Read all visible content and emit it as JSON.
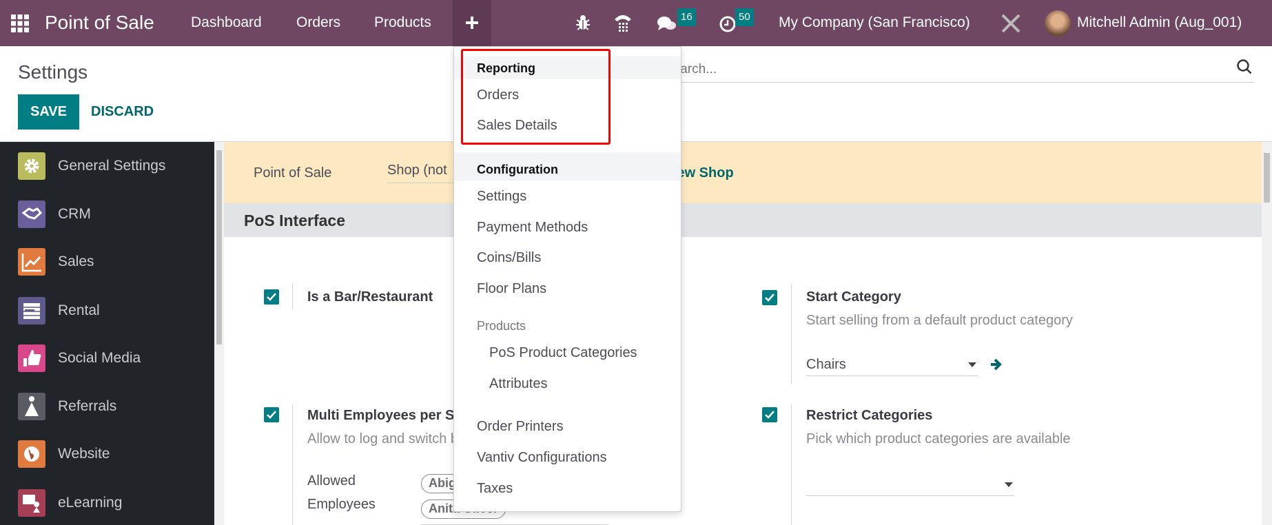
{
  "navbar": {
    "app_title": "Point of Sale",
    "menu": [
      "Dashboard",
      "Orders",
      "Products"
    ],
    "new_icon": "plus-icon",
    "messages_count": "16",
    "activities_count": "50",
    "company": "My Company (San Francisco)",
    "user": "Mitchell Admin (Aug_001)",
    "color": "#704762"
  },
  "control_panel": {
    "title": "Settings",
    "save_label": "SAVE",
    "discard_label": "DISCARD",
    "search_placeholder": "Search..."
  },
  "sidebar": {
    "items": [
      {
        "label": "General Settings",
        "color": "#b9bb5c"
      },
      {
        "label": "CRM",
        "color": "#6b5e9c"
      },
      {
        "label": "Sales",
        "color": "#e07a3f"
      },
      {
        "label": "Rental",
        "color": "#5e5a8e"
      },
      {
        "label": "Social Media",
        "color": "#d8488a"
      },
      {
        "label": "Referrals",
        "color": "#5b5b63"
      },
      {
        "label": "Website",
        "color": "#e07a3f"
      },
      {
        "label": "eLearning",
        "color": "#a63f55"
      }
    ]
  },
  "content": {
    "shop_bar": {
      "label": "Point of Sale",
      "shop_value": "Shop (not",
      "new_shop": "New Shop"
    },
    "section": "PoS Interface",
    "settings": [
      {
        "title": "Is a Bar/Restaurant",
        "checked": true
      },
      {
        "title": "Multi Employees per Session",
        "desc": "Allow to log and switch between selected Employees",
        "checked": true,
        "field_label_1": "Allowed",
        "field_label_2": "Employees",
        "tags": [
          "Abigail Peterson",
          "Anita Oliver"
        ]
      },
      {
        "title": "Start Category",
        "desc": "Start selling from a default product category",
        "value": "Chairs",
        "checked": true
      },
      {
        "title": "Restrict Categories",
        "desc": "Pick which product categories are available",
        "value": "",
        "checked": true
      }
    ]
  },
  "dropdown": {
    "reporting_header": "Reporting",
    "reporting_items": [
      "Orders",
      "Sales Details"
    ],
    "configuration_header": "Configuration",
    "configuration_items": [
      "Settings",
      "Payment Methods",
      "Coins/Bills",
      "Floor Plans"
    ],
    "products_header": "Products",
    "products_items": [
      "PoS Product Categories",
      "Attributes"
    ],
    "other_items": [
      "Order Printers",
      "Vantiv Configurations",
      "Taxes"
    ],
    "highlight_color": "#ff0000"
  }
}
